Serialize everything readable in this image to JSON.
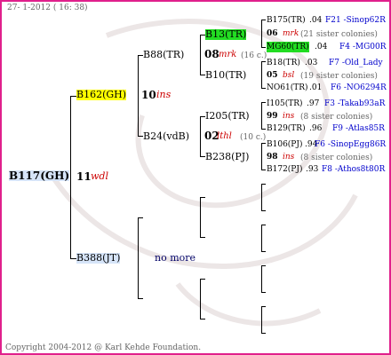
{
  "header": "27- 1-2012 ( 16: 38)",
  "footer": "Copyright 2004-2012 @ Karl Kehde Foundation.",
  "root": {
    "id": "B117(GH)",
    "num": "11",
    "mark": "wdl"
  },
  "gen1": {
    "top": {
      "id": "B162(GH)",
      "num": "10",
      "mark": "ins"
    },
    "bottom": {
      "id": "B388(JT)",
      "note": "no more"
    }
  },
  "gen2": {
    "a": {
      "id": "B88(TR)",
      "num": "08",
      "mark": "mrk",
      "count": "(16 c.)"
    },
    "b": {
      "id": "B24(vdB)",
      "num": "02",
      "mark": "lthl",
      "count": "(10 c.)"
    }
  },
  "gen3": {
    "a": {
      "id": "B13(TR)"
    },
    "b": {
      "id": "B10(TR)"
    },
    "c": {
      "id": "I205(TR)"
    },
    "d": {
      "id": "B238(PJ)"
    }
  },
  "gen4": [
    {
      "id": "B175(TR)",
      "val": ".04",
      "link": "F21 -Sinop62R"
    },
    {
      "num": "06",
      "mark": "mrk",
      "note": "(21 sister colonies)"
    },
    {
      "id": "MG60(TR)",
      "val": ".04",
      "link": "F4 -MG00R"
    },
    {
      "id": "B18(TR)",
      "val": ".03",
      "link": "F7 -Old_Lady"
    },
    {
      "num": "05",
      "mark": "bsl",
      "note": "(19 sister colonies)"
    },
    {
      "id": "NO61(TR)",
      "val": ".01",
      "link": "F6 -NO6294R"
    },
    {
      "id": "I105(TR)",
      "val": ".97",
      "link": "F3 -Takab93aR"
    },
    {
      "num": "99",
      "mark": "ins",
      "note": "(8 sister colonies)"
    },
    {
      "id": "B129(TR)",
      "val": ".96",
      "link": "F9 -Atlas85R"
    },
    {
      "id": "B106(PJ)",
      "val": ".94",
      "link": "F6 -SinopEgg86R"
    },
    {
      "num": "98",
      "mark": "ins",
      "note": "(8 sister colonies)"
    },
    {
      "id": "B172(PJ)",
      "val": ".93",
      "link": "F8 -Athos8t80R"
    }
  ]
}
